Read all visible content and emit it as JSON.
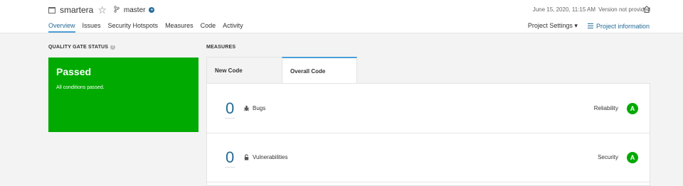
{
  "header": {
    "project_name": "smartera",
    "branch": "master",
    "date": "June 15, 2020, 11:15 AM",
    "version": "Version not provided",
    "nav": {
      "overview": "Overview",
      "issues": "Issues",
      "security_hotspots": "Security Hotspots",
      "measures": "Measures",
      "code": "Code",
      "activity": "Activity"
    },
    "project_settings": "Project Settings",
    "project_information": "Project information"
  },
  "quality_gate": {
    "title": "QUALITY GATE STATUS",
    "status": "Passed",
    "description": "All conditions passed.",
    "color": "#00aa00"
  },
  "measures": {
    "title": "MEASURES",
    "tabs": {
      "new_code": "New Code",
      "overall_code": "Overall Code"
    },
    "rows": [
      {
        "value": "0",
        "label": "Bugs",
        "icon": "bug-icon",
        "rating_label": "Reliability",
        "rating": "A"
      },
      {
        "value": "0",
        "label": "Vulnerabilities",
        "icon": "lock-icon",
        "rating_label": "Security",
        "rating": "A"
      }
    ]
  },
  "colors": {
    "accent": "#236a97",
    "passed": "#00aa00"
  }
}
